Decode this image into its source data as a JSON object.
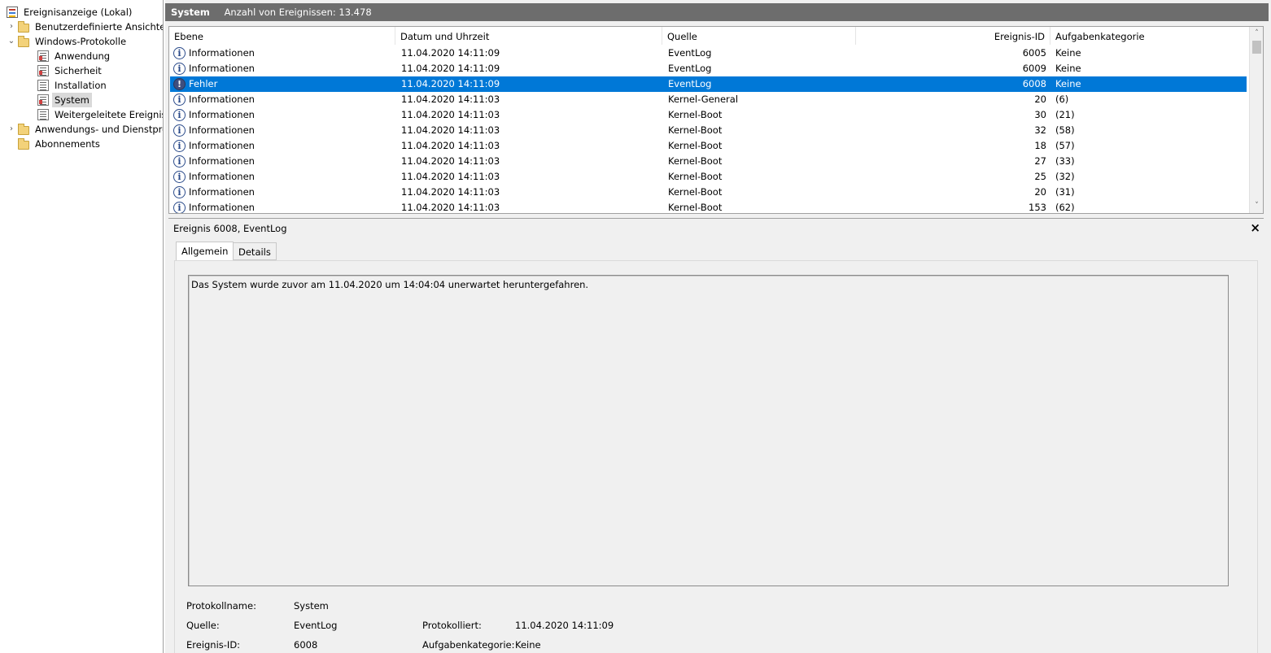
{
  "tree": {
    "items": [
      {
        "label": "Ereignisanzeige (Lokal)",
        "chevron": "",
        "icon": "event-viewer-icon"
      },
      {
        "label": "Benutzerdefinierte Ansichten",
        "chevron": "›",
        "icon": "folder-icon"
      },
      {
        "label": "Windows-Protokolle",
        "chevron": "⌄",
        "icon": "folder-icon"
      },
      {
        "label": "Anwendung",
        "chevron": "",
        "icon": "log-icon"
      },
      {
        "label": "Sicherheit",
        "chevron": "",
        "icon": "log-icon"
      },
      {
        "label": "Installation",
        "chevron": "",
        "icon": "log-icon"
      },
      {
        "label": "System",
        "chevron": "",
        "icon": "log-icon",
        "selected": true
      },
      {
        "label": "Weitergeleitete Ereignisse",
        "chevron": "",
        "icon": "log-icon"
      },
      {
        "label": "Anwendungs- und Dienstprotokolle",
        "chevron": "›",
        "icon": "folder-icon"
      },
      {
        "label": "Abonnements",
        "chevron": "",
        "icon": "subscription-icon"
      }
    ]
  },
  "header": {
    "title": "System",
    "count": "Anzahl von Ereignissen: 13.478"
  },
  "grid": {
    "columns": [
      "Ebene",
      "Datum und Uhrzeit",
      "Quelle",
      "Ereignis-ID",
      "Aufgabenkategorie"
    ],
    "rows": [
      {
        "level": "Informationen",
        "date": "11.04.2020 14:11:09",
        "source": "EventLog",
        "id": "6005",
        "task": "Keine",
        "type": "info"
      },
      {
        "level": "Informationen",
        "date": "11.04.2020 14:11:09",
        "source": "EventLog",
        "id": "6009",
        "task": "Keine",
        "type": "info"
      },
      {
        "level": "Fehler",
        "date": "11.04.2020 14:11:09",
        "source": "EventLog",
        "id": "6008",
        "task": "Keine",
        "type": "error",
        "selected": true
      },
      {
        "level": "Informationen",
        "date": "11.04.2020 14:11:03",
        "source": "Kernel-General",
        "id": "20",
        "task": "(6)",
        "type": "info"
      },
      {
        "level": "Informationen",
        "date": "11.04.2020 14:11:03",
        "source": "Kernel-Boot",
        "id": "30",
        "task": "(21)",
        "type": "info"
      },
      {
        "level": "Informationen",
        "date": "11.04.2020 14:11:03",
        "source": "Kernel-Boot",
        "id": "32",
        "task": "(58)",
        "type": "info"
      },
      {
        "level": "Informationen",
        "date": "11.04.2020 14:11:03",
        "source": "Kernel-Boot",
        "id": "18",
        "task": "(57)",
        "type": "info"
      },
      {
        "level": "Informationen",
        "date": "11.04.2020 14:11:03",
        "source": "Kernel-Boot",
        "id": "27",
        "task": "(33)",
        "type": "info"
      },
      {
        "level": "Informationen",
        "date": "11.04.2020 14:11:03",
        "source": "Kernel-Boot",
        "id": "25",
        "task": "(32)",
        "type": "info"
      },
      {
        "level": "Informationen",
        "date": "11.04.2020 14:11:03",
        "source": "Kernel-Boot",
        "id": "20",
        "task": "(31)",
        "type": "info"
      },
      {
        "level": "Informationen",
        "date": "11.04.2020 14:11:03",
        "source": "Kernel-Boot",
        "id": "153",
        "task": "(62)",
        "type": "info"
      }
    ],
    "info_glyph": "i",
    "error_glyph": "!"
  },
  "scrollbar": {
    "up": "˄",
    "down": "˅"
  },
  "details": {
    "title": "Ereignis 6008, EventLog",
    "close": "×",
    "tabs": [
      "Allgemein",
      "Details"
    ],
    "description": "Das System wurde zuvor am 11.04.2020 um 14:04:04 unerwartet heruntergefahren.",
    "props": {
      "logname_label": "Protokollname:",
      "logname_value": "System",
      "source_label": "Quelle:",
      "source_value": "EventLog",
      "logged_label": "Protokolliert:",
      "logged_value": "11.04.2020 14:11:09",
      "eventid_label": "Ereignis-ID:",
      "eventid_value": "6008",
      "task_label": "Aufgabenkategorie:",
      "task_value": "Keine"
    }
  },
  "colors": {
    "selection": "#0078d7",
    "header_bar": "#6d6d6d"
  }
}
